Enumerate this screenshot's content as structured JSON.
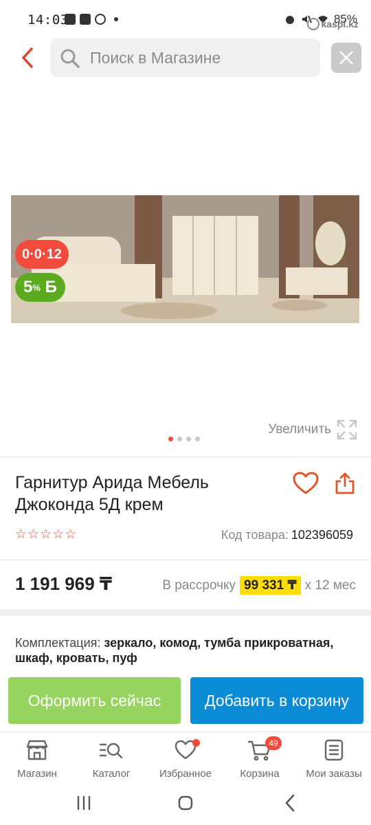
{
  "status_bar": {
    "time": "14:03",
    "battery": "85%",
    "watermark": "kaspi.kz"
  },
  "search": {
    "placeholder": "Поиск в Магазине"
  },
  "gallery": {
    "badge_credit": "0·0·12",
    "badge_bonus_value": "5",
    "badge_bonus_unit": "%",
    "badge_bonus_symbol": "Б",
    "zoom_label": "Увеличить",
    "dots_total": 4,
    "dots_active": 1
  },
  "product": {
    "title": "Гарнитур Арида Мебель Джоконда 5Д крем",
    "rating_stars": 0,
    "rating_max": 5,
    "sku_label": "Код товара:",
    "sku_value": "102396059",
    "price": "1 191 969 ₸",
    "installment_label": "В рассрочку",
    "installment_amount": "99 331 ₸",
    "installment_term": "х 12 мес",
    "complect_label": "Комплектация:",
    "complect_value": "зеркало, комод, тумба прикроватная, шкаф, кровать, пуф"
  },
  "actions": {
    "checkout_label": "Оформить сейчас",
    "add_to_cart_label": "Добавить в корзину"
  },
  "tabbar": {
    "items": [
      {
        "label": "Магазин",
        "icon": "store-icon"
      },
      {
        "label": "Каталог",
        "icon": "catalog-search-icon"
      },
      {
        "label": "Избранное",
        "icon": "heart-icon"
      },
      {
        "label": "Корзина",
        "icon": "cart-icon",
        "badge": "49"
      },
      {
        "label": "Мои заказы",
        "icon": "orders-icon"
      }
    ]
  },
  "colors": {
    "brand_red": "#f24a3c",
    "checkout_green": "#97d45f",
    "cart_blue": "#0b8ad6",
    "installment_yellow": "#ffdd00",
    "bonus_green": "#5cab1e"
  }
}
